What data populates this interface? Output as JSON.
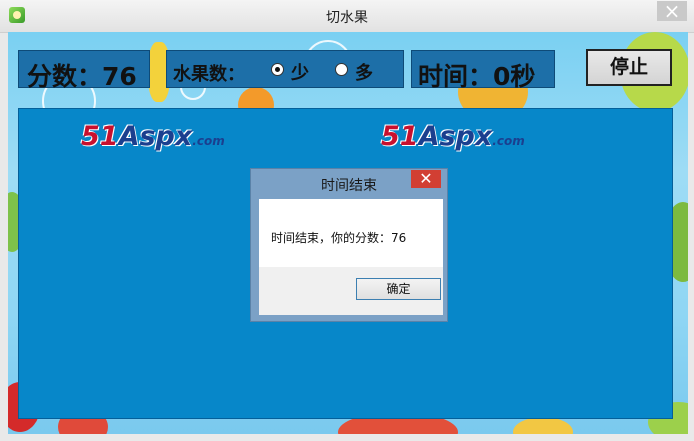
{
  "window": {
    "title": "切水果"
  },
  "score": {
    "text": "分数：76"
  },
  "fruit_count": {
    "label": "水果数：",
    "options": [
      {
        "label": "少",
        "selected": true
      },
      {
        "label": "多",
        "selected": false
      }
    ]
  },
  "timer": {
    "text": "时间：0秒"
  },
  "stop_button": {
    "label": "停止"
  },
  "watermarks": [
    {
      "number": "51",
      "word": "Aspx",
      "suffix": ".com"
    },
    {
      "number": "51",
      "word": "Aspx",
      "suffix": ".com"
    }
  ],
  "dialog": {
    "title": "时间结束",
    "message": "时间结束，你的分数：76",
    "ok_label": "确定"
  },
  "colors": {
    "board": "#0787c9",
    "panel": "#1d6fa8",
    "dialog_frame": "#7ba1c6",
    "dialog_close": "#d23f33"
  },
  "icons": {
    "app": "fruit-icon",
    "close": "close-icon"
  }
}
